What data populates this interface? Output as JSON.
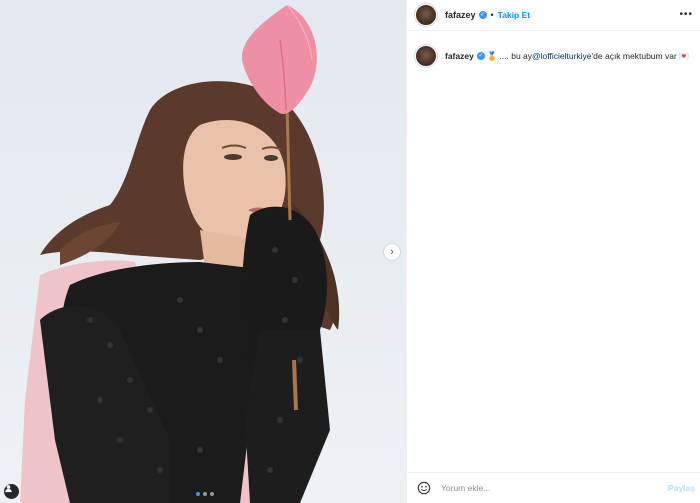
{
  "post": {
    "username": "fafazey",
    "follow_label": "Takip Et",
    "separator": "•",
    "more_icon": "more-icon",
    "caption": {
      "username": "fafazey",
      "emoji": "🏅",
      "text_before": ".... bu ay ",
      "mention": "@lofficielturkiye",
      "text_after": " 'de açık mektubum var",
      "end_emoji": "💌"
    },
    "comment_placeholder": "Yorum ekle...",
    "post_label": "Paylaş",
    "carousel_dots": 3,
    "accent_color": "#0095f6"
  }
}
